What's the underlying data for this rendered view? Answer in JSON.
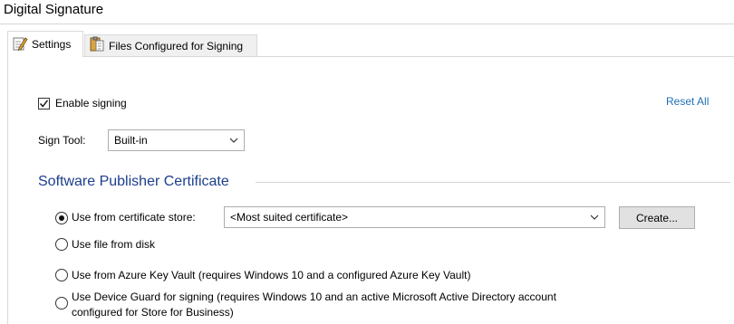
{
  "window": {
    "title": "Digital Signature"
  },
  "tabs": [
    {
      "label": "Settings",
      "icon": "settings-pencil-icon",
      "active": true
    },
    {
      "label": "Files Configured for Signing",
      "icon": "files-clipboard-icon",
      "active": false
    }
  ],
  "signing": {
    "enable_label": "Enable signing",
    "enabled": true
  },
  "reset_all_label": "Reset All",
  "sign_tool": {
    "label": "Sign Tool:",
    "value": "Built-in"
  },
  "certificate_section": {
    "title": "Software Publisher Certificate",
    "options": [
      {
        "label": "Use from certificate store:",
        "selected": true
      },
      {
        "label": "Use file from disk",
        "selected": false
      },
      {
        "label": "Use from Azure Key Vault (requires Windows 10 and a configured Azure Key Vault)",
        "selected": false
      },
      {
        "label_line1": "Use Device Guard for signing (requires Windows 10 and an active Microsoft Active Directory account",
        "label_line2": "configured for Store for Business)",
        "selected": false
      }
    ],
    "certificate_select_value": "<Most suited certificate>",
    "create_button_label": "Create..."
  },
  "colors": {
    "accent_link": "#1f6fb5",
    "section_title": "#1b3e8c"
  }
}
